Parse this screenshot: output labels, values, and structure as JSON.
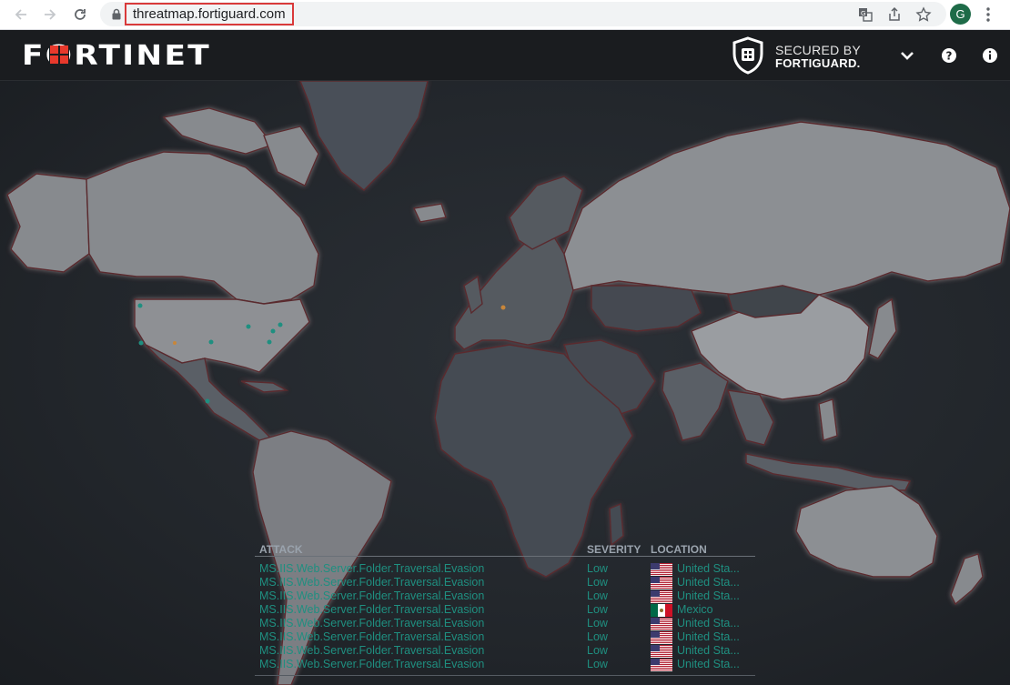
{
  "browser": {
    "url": "threatmap.fortiguard.com",
    "profile_initial": "G"
  },
  "header": {
    "logo_text": "FORTINET",
    "secured_line1": "SECURED BY",
    "secured_line2": "FORTIGUARD."
  },
  "table": {
    "headers": {
      "attack": "ATTACK",
      "severity": "SEVERITY",
      "location": "LOCATION"
    },
    "rows": [
      {
        "attack": "MS.IIS.Web.Server.Folder.Traversal.Evasion",
        "severity": "Low",
        "location": "United Sta...",
        "flag": "us-flag-icon"
      },
      {
        "attack": "MS.IIS.Web.Server.Folder.Traversal.Evasion",
        "severity": "Low",
        "location": "United Sta...",
        "flag": "us-flag-icon"
      },
      {
        "attack": "MS.IIS.Web.Server.Folder.Traversal.Evasion",
        "severity": "Low",
        "location": "United Sta...",
        "flag": "us-flag-icon"
      },
      {
        "attack": "MS.IIS.Web.Server.Folder.Traversal.Evasion",
        "severity": "Low",
        "location": "Mexico",
        "flag": "mx-flag-icon"
      },
      {
        "attack": "MS.IIS.Web.Server.Folder.Traversal.Evasion",
        "severity": "Low",
        "location": "United Sta...",
        "flag": "us-flag-icon"
      },
      {
        "attack": "MS.IIS.Web.Server.Folder.Traversal.Evasion",
        "severity": "Low",
        "location": "United Sta...",
        "flag": "us-flag-icon"
      },
      {
        "attack": "MS.IIS.Web.Server.Folder.Traversal.Evasion",
        "severity": "Low",
        "location": "United Sta...",
        "flag": "us-flag-icon"
      },
      {
        "attack": "MS.IIS.Web.Server.Folder.Traversal.Evasion",
        "severity": "Low",
        "location": "United Sta...",
        "flag": "us-flag-icon"
      }
    ]
  },
  "colors": {
    "accent_red": "#d93a3a",
    "attack_text": "#1f8f80",
    "land": "#8a8d91",
    "land_dark": "#4a5058"
  }
}
